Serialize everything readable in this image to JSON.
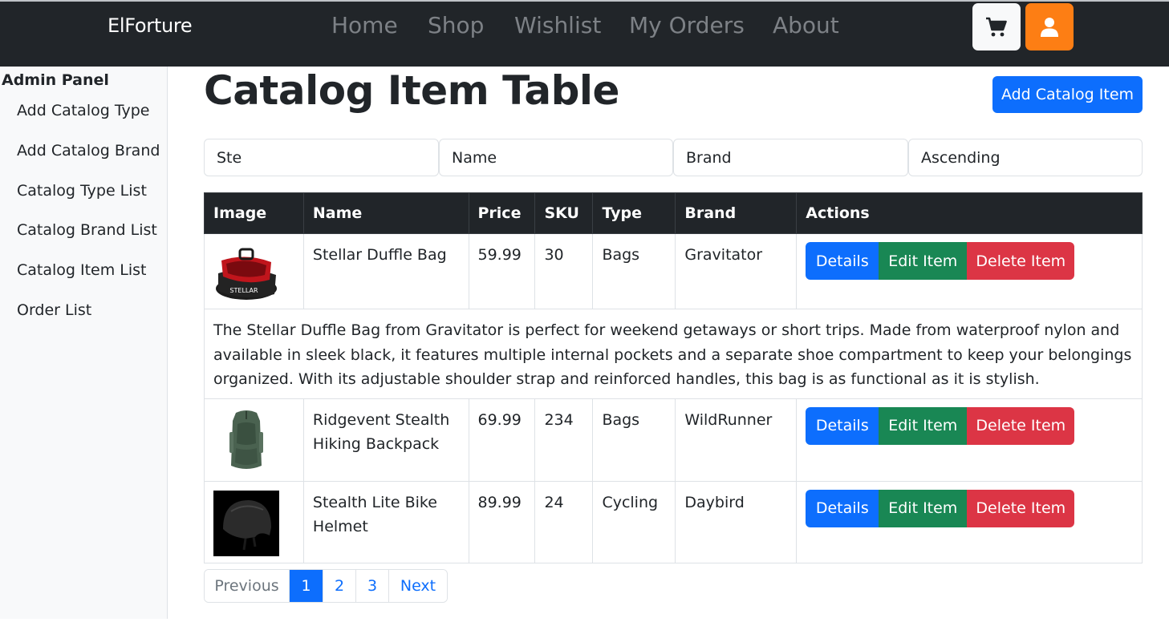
{
  "navbar": {
    "brand": "ElForture",
    "links": [
      "Home",
      "Shop",
      "Wishlist",
      "My Orders",
      "About"
    ],
    "cart_icon": "cart-icon",
    "user_icon": "user-icon",
    "colors": {
      "bar": "#212529",
      "cart_bg": "#f8f9fa",
      "user_bg": "#fd7e14"
    }
  },
  "sidebar": {
    "title": "Admin Panel",
    "items": [
      "Add Catalog Type",
      "Add Catalog Brand",
      "Catalog Type List",
      "Catalog Brand List",
      "Catalog Item List",
      "Order List"
    ]
  },
  "main": {
    "title": "Catalog Item Table",
    "add_button": "Add Catalog Item",
    "filters": [
      "Ste",
      "Name",
      "Brand",
      "Ascending"
    ]
  },
  "table": {
    "headers": [
      "Image",
      "Name",
      "Price",
      "SKU",
      "Type",
      "Brand",
      "Actions"
    ],
    "actions": {
      "details": "Details",
      "edit": "Edit Item",
      "delete": "Delete Item"
    },
    "rows": [
      {
        "name": "Stellar Duffle Bag",
        "price": "59.99",
        "sku": "30",
        "type": "Bags",
        "brand": "Gravitator",
        "image_label": "STELLAR"
      },
      {
        "name": "Ridgevent Stealth Hiking Backpack",
        "price": "69.99",
        "sku": "234",
        "type": "Bags",
        "brand": "WildRunner"
      },
      {
        "name": "Stealth Lite Bike Helmet",
        "price": "89.99",
        "sku": "24",
        "type": "Cycling",
        "brand": "Daybird"
      }
    ],
    "description": "The Stellar Duffle Bag from Gravitator is perfect for weekend getaways or short trips. Made from waterproof nylon and available in sleek black, it features multiple internal pockets and a separate shoe compartment to keep your belongings organized. With its adjustable shoulder strap and reinforced handles, this bag is as functional as it is stylish."
  },
  "pagination": {
    "previous": "Previous",
    "pages": [
      "1",
      "2",
      "3"
    ],
    "next": "Next",
    "current": "1"
  }
}
